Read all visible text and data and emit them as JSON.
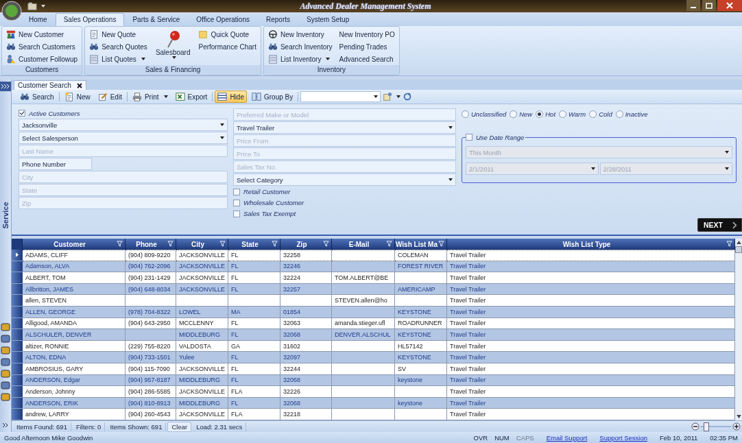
{
  "window": {
    "title": "Advanced Dealer Management System"
  },
  "ribbon": {
    "tabs": [
      {
        "label": "Home",
        "selected": false
      },
      {
        "label": "Sales Operations",
        "selected": true
      },
      {
        "label": "Parts & Service",
        "selected": false
      },
      {
        "label": "Office Operations",
        "selected": false
      },
      {
        "label": "Reports",
        "selected": false
      },
      {
        "label": "System Setup",
        "selected": false
      }
    ],
    "groups": [
      {
        "label": "Customers",
        "columns": [
          [
            {
              "label": "New Customer",
              "menu": false
            },
            {
              "label": "Search Customers",
              "menu": false
            },
            {
              "label": "Customer Followup",
              "menu": false
            }
          ]
        ]
      },
      {
        "label": "Sales & Financing",
        "columns": [
          [
            {
              "label": "New Quote",
              "menu": false
            },
            {
              "label": "Search Quotes",
              "menu": false
            },
            {
              "label": "List Quotes",
              "menu": true
            }
          ],
          [
            {
              "label": "Salesboard",
              "menu": true,
              "kind": "large"
            }
          ],
          [
            {
              "label": "Quick Quote",
              "menu": false
            },
            {
              "label": "Performance Chart",
              "menu": false
            }
          ]
        ]
      },
      {
        "label": "Inventory",
        "columns": [
          [
            {
              "label": "New Inventory",
              "menu": false
            },
            {
              "label": "Search Inventory",
              "menu": false
            },
            {
              "label": "List Inventory",
              "menu": true
            }
          ],
          [
            {
              "label": "New Inventory PO",
              "menu": false
            },
            {
              "label": "Pending Trades",
              "menu": false
            },
            {
              "label": "Advanced Search",
              "menu": false
            }
          ]
        ]
      }
    ]
  },
  "side_panel": {
    "label": "Service"
  },
  "document_tab": {
    "label": "Customer Search",
    "selected": true
  },
  "toolbar": {
    "buttons": [
      {
        "label": "Search",
        "menu": false,
        "on": false
      },
      {
        "label": "New",
        "menu": false,
        "on": false
      },
      {
        "label": "Edit",
        "menu": false,
        "on": false
      },
      {
        "label": "Print",
        "menu": true,
        "on": false
      },
      {
        "label": "Export",
        "menu": false,
        "on": false
      },
      {
        "label": "Hide",
        "menu": false,
        "on": true
      },
      {
        "label": "Group By",
        "menu": false,
        "on": false
      }
    ]
  },
  "filters": {
    "active_customers": {
      "label": "Active Customers",
      "checked": true
    },
    "left_fields": [
      {
        "kind": "select",
        "value": "Jacksonville"
      },
      {
        "kind": "select",
        "value": "Select Salesperson"
      },
      {
        "kind": "input",
        "placeholder": "Last Name"
      },
      {
        "kind": "short",
        "value": "Phone Number"
      },
      {
        "kind": "input",
        "placeholder": "City"
      },
      {
        "kind": "input",
        "placeholder": "State"
      },
      {
        "kind": "input",
        "placeholder": "Zip"
      }
    ],
    "middle_fields": [
      {
        "kind": "input",
        "placeholder": "Preferred Make or Model"
      },
      {
        "kind": "select",
        "value": "Travel Trailer"
      },
      {
        "kind": "input",
        "placeholder": "Price From"
      },
      {
        "kind": "input",
        "placeholder": "Price To"
      },
      {
        "kind": "input",
        "placeholder": "Sales Tax No."
      },
      {
        "kind": "select",
        "value": "Select Category"
      }
    ],
    "checkboxes": [
      {
        "label": "Retail Customer",
        "checked": false
      },
      {
        "label": "Wholesale Customer",
        "checked": false
      },
      {
        "label": "Sales Tax Exempt",
        "checked": false
      }
    ],
    "status": [
      {
        "label": "Unclassified",
        "selected": false
      },
      {
        "label": "New",
        "selected": false
      },
      {
        "label": "Hot",
        "selected": true
      },
      {
        "label": "Warm",
        "selected": false
      },
      {
        "label": "Cold",
        "selected": false
      },
      {
        "label": "Inactive",
        "selected": false
      }
    ],
    "date_range": {
      "label": "Use Date Range",
      "checked": false,
      "period": "This Month",
      "from": "2/1/2011",
      "to": "2/28/2011",
      "disabled": true
    },
    "next_button": "NEXT"
  },
  "table": {
    "columns": [
      "Customer",
      "Phone",
      "City",
      "State",
      "Zip",
      "E-Mail",
      "Wish List Ma",
      "Wish List Type"
    ],
    "rows": [
      {
        "selected": true,
        "cells": [
          "ADAMS, CLIFF",
          "(904) 809-9220",
          "JACKSONVILLE",
          "FL",
          "32258",
          null,
          "COLEMAN",
          "Travel Trailer"
        ]
      },
      {
        "selected": false,
        "cells": [
          "Adamson, ALVA",
          "(904) 762-2096",
          "JACKSONVILLE",
          "FL",
          "32246",
          null,
          "FOREST RIVER",
          "Travel Trailer"
        ]
      },
      {
        "selected": false,
        "cells": [
          "ALBERT, TOM",
          "(904) 231-1429",
          "JACKSONVILLE",
          "FL",
          "32224",
          "TOM.ALBERT@BE",
          null,
          "Travel Trailer"
        ]
      },
      {
        "selected": false,
        "cells": [
          "Allbritton, JAMES",
          "(904) 648-8034",
          "JACKSONVILLE",
          "FL",
          "32257",
          null,
          "AMERICAMP",
          "Travel Trailer"
        ]
      },
      {
        "selected": false,
        "cells": [
          "allen, STEVEN",
          null,
          null,
          null,
          null,
          "STEVEN.allen@ho",
          null,
          "Travel Trailer"
        ]
      },
      {
        "selected": false,
        "cells": [
          "ALLEN, GEORGE",
          "(978) 704-8322",
          "LOWEL",
          "MA",
          "01854",
          null,
          "KEYSTONE",
          "Travel Trailer"
        ]
      },
      {
        "selected": false,
        "cells": [
          "Alligood, AMANDA",
          "(904) 643-2950",
          "MCCLENNY",
          "FL",
          "32063",
          "amanda.stieger.ufl",
          "ROADRUNNER",
          "Travel Trailer"
        ]
      },
      {
        "selected": false,
        "cells": [
          "ALSCHULER, DENVER",
          null,
          "MIDDLEBURG",
          "FL",
          "32068",
          "DENVER.ALSCHUL",
          "KEYSTONE",
          "Travel Trailer"
        ]
      },
      {
        "selected": false,
        "cells": [
          "altizer, RONNIE",
          "(229) 755-8220",
          "VALDOSTA",
          "GA",
          "31602",
          null,
          "HL57142",
          "Travel Trailer"
        ]
      },
      {
        "selected": false,
        "cells": [
          "ALTON, EDNA",
          "(904) 733-1501",
          "Yulee",
          "FL",
          "32097",
          null,
          "KEYSTONE",
          "Travel Trailer"
        ]
      },
      {
        "selected": false,
        "cells": [
          "AMBROSIUS, GARY",
          "(904) 115-7090",
          "JACKSONVILLE",
          "FL",
          "32244",
          null,
          "SV",
          "Travel Trailer"
        ]
      },
      {
        "selected": false,
        "cells": [
          "ANDERSON, Edgar",
          "(904) 957-8187",
          "MIDDLEBURG",
          "FL",
          "32068",
          null,
          "keystone",
          "Travel Trailer"
        ]
      },
      {
        "selected": false,
        "cells": [
          "Anderson, Johnny",
          "(904) 286-5585",
          "JACKSONVILLE",
          "FLA",
          "32226",
          null,
          null,
          "Travel Trailer"
        ]
      },
      {
        "selected": false,
        "cells": [
          "ANDERSON, ERIK",
          "(904) 810-8913",
          "MIDDLEBURG",
          "FL",
          "32068",
          null,
          "keystone",
          "Travel Trailer"
        ]
      },
      {
        "selected": false,
        "cells": [
          "andrew, LARRY",
          "(904) 260-4543",
          "JACKSONVILLE",
          "FLA",
          "32218",
          null,
          null,
          "Travel Trailer"
        ]
      }
    ]
  },
  "zoom": {
    "level": 0.1
  },
  "summary_bar": [
    {
      "kind": "text",
      "label": "Items Found: 691"
    },
    {
      "kind": "text",
      "label": "Filters: 0"
    },
    {
      "kind": "text",
      "label": "Items Shown: 691"
    },
    {
      "kind": "button",
      "label": "Clear"
    },
    {
      "kind": "text",
      "label": "Load: 2.31 secs"
    }
  ],
  "status_bar": {
    "greeting": "Good Afternoon Mike Goodwin",
    "indicators": [
      {
        "label": "OVR",
        "on": true
      },
      {
        "label": "NUM",
        "on": true
      },
      {
        "label": "CAPS",
        "on": false
      }
    ],
    "links": [
      "Email Support",
      "Support Session"
    ],
    "date": "Feb 10, 2011",
    "time": "02:35 PM"
  }
}
